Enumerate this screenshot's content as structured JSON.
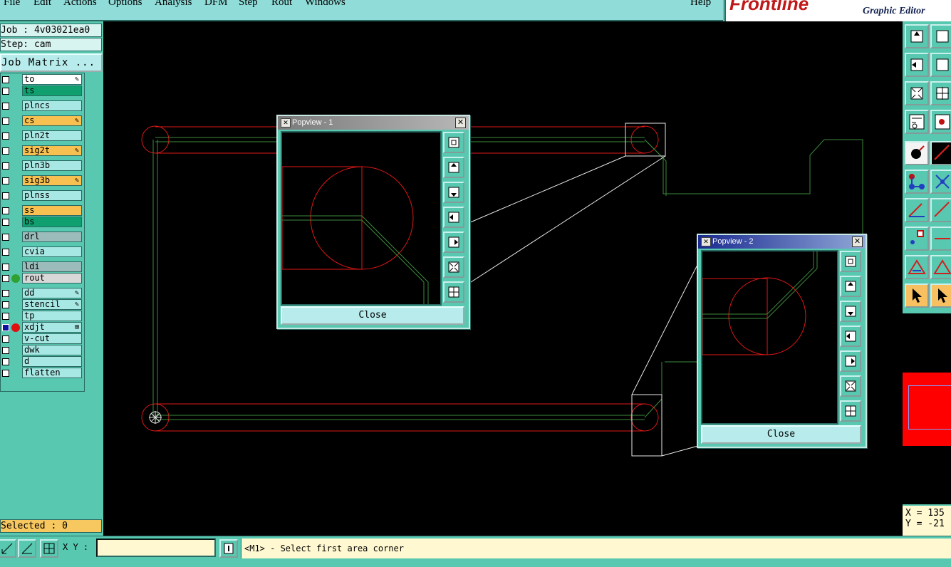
{
  "menubar": {
    "items": [
      "File",
      "Edit",
      "Actions",
      "Options",
      "Analysis",
      "DFM",
      "Step",
      "Rout",
      "Windows"
    ],
    "help": "Help"
  },
  "logo": {
    "brand": "Frontline",
    "subtitle": "Graphic Editor"
  },
  "job": {
    "job_label": "Job : 4v03021ea0",
    "step_label": "Step: cam",
    "matrix_button": "Job Matrix ..."
  },
  "layers": [
    {
      "name": "to",
      "color": "#ffffff",
      "mark": "✎"
    },
    {
      "name": "ts",
      "color": "#10a070",
      "mark": ""
    },
    {
      "name": "plncs",
      "color": "#a8e8e4",
      "mark": ""
    },
    {
      "name": "cs",
      "color": "#f8c050",
      "mark": "✎"
    },
    {
      "name": "pln2t",
      "color": "#a8e8e4",
      "mark": ""
    },
    {
      "name": "sig2t",
      "color": "#f8c050",
      "mark": "✎"
    },
    {
      "name": "pln3b",
      "color": "#a8e8e4",
      "mark": ""
    },
    {
      "name": "sig3b",
      "color": "#f8c050",
      "mark": "✎"
    },
    {
      "name": "plnss",
      "color": "#a8e8e4",
      "mark": ""
    },
    {
      "name": "ss",
      "color": "#f8c050",
      "mark": ""
    },
    {
      "name": "bs",
      "color": "#10a070",
      "mark": ""
    },
    {
      "name": "drl",
      "color": "#9cbcbc",
      "mark": ""
    },
    {
      "name": "cvia",
      "color": "#a8e8e4",
      "mark": ""
    },
    {
      "name": "ldi",
      "color": "#9cbcbc",
      "mark": ""
    },
    {
      "name": "rout",
      "color": "#d8d8d8",
      "mark": "",
      "dot": "#30a030"
    },
    {
      "name": "dd",
      "color": "#a8e8e4",
      "mark": "✎"
    },
    {
      "name": "stencil",
      "color": "#a8e8e4",
      "mark": "✎"
    },
    {
      "name": "tp",
      "color": "#a8e8e4",
      "mark": ""
    },
    {
      "name": "xdjt",
      "color": "#a8e8e4",
      "mark": "⊞",
      "dot": "#e01010",
      "checked": true
    },
    {
      "name": "v-cut",
      "color": "#a8e8e4",
      "mark": ""
    },
    {
      "name": "dwk",
      "color": "#a8e8e4",
      "mark": ""
    },
    {
      "name": "d",
      "color": "#a8e8e4",
      "mark": ""
    },
    {
      "name": "flatten",
      "color": "#a8e8e4",
      "mark": ""
    }
  ],
  "selected": "Selected : 0",
  "popview1": {
    "title": "Popview - 1",
    "close": "Close"
  },
  "popview2": {
    "title": "Popview - 2",
    "close": "Close"
  },
  "colors": {
    "trace_red": "#e01818",
    "trace_green": "#3c8a3c",
    "titlebar1": "#9a9a9a",
    "titlebar2": "#2838a0"
  },
  "coords": {
    "x": "X = 135",
    "y": "Y = -21"
  },
  "bottom": {
    "xy_label": "X Y :",
    "xy_value": "",
    "message": "<M1> - Select first area corner"
  }
}
